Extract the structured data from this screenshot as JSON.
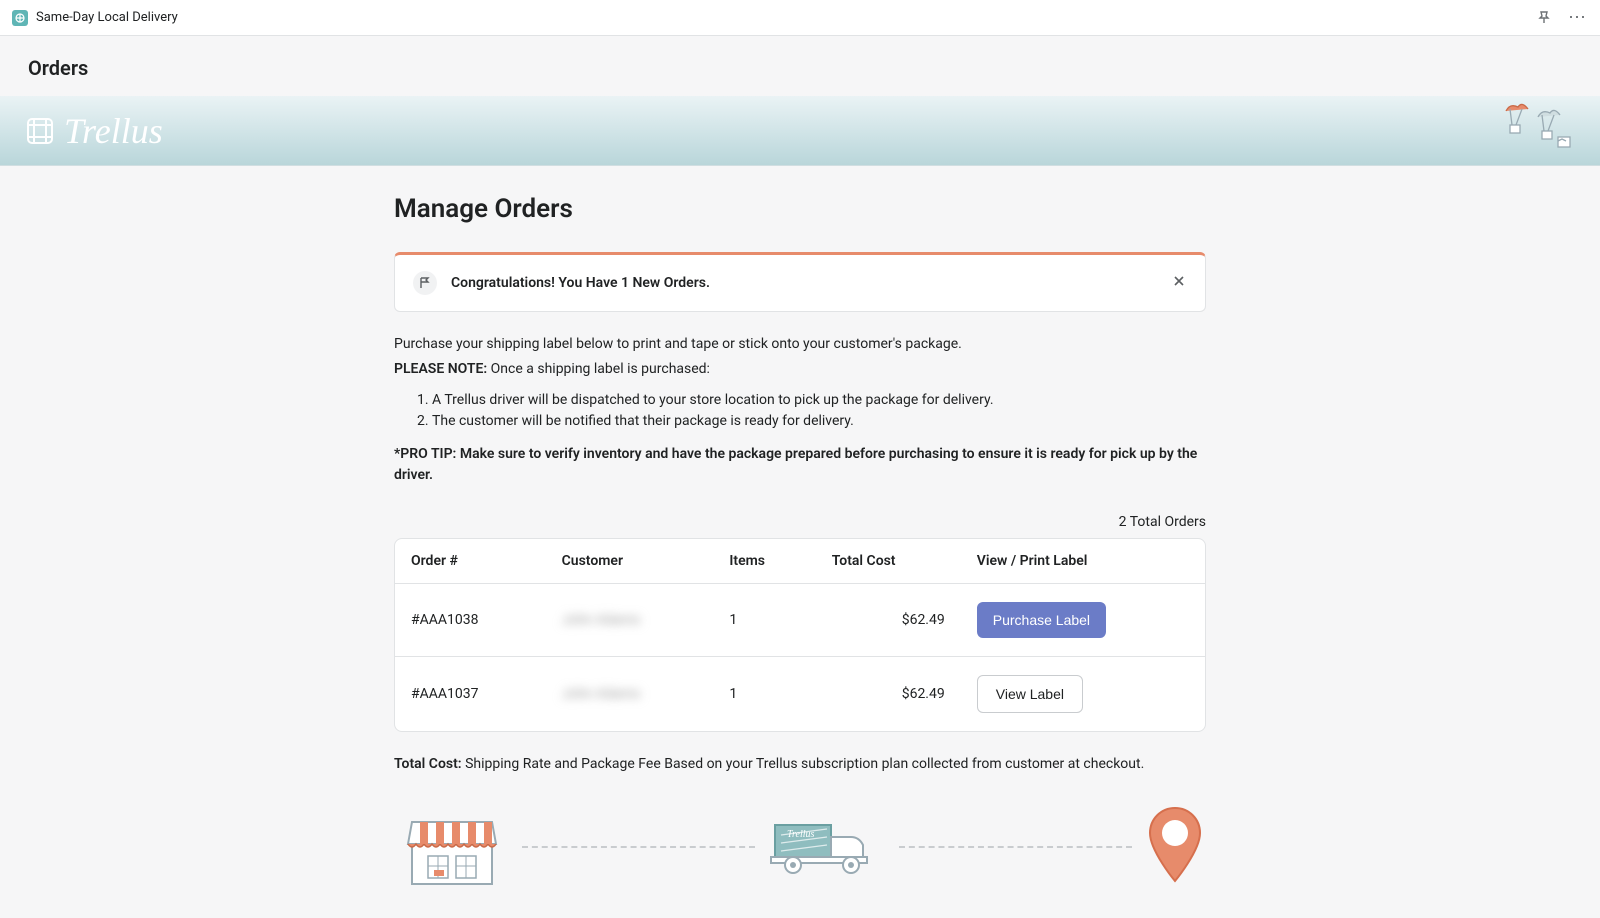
{
  "topbar": {
    "app_title": "Same-Day Local Delivery"
  },
  "page_header": "Orders",
  "brand_name": "Trellus",
  "main_title": "Manage Orders",
  "alert": {
    "text": "Congratulations! You Have 1 New Orders."
  },
  "info": {
    "intro": "Purchase your shipping label below to print and tape or stick onto your customer's package.",
    "please_note_label": "PLEASE NOTE:",
    "please_note_text": " Once a shipping label is purchased:",
    "list_1": "A Trellus driver will be dispatched to your store location to pick up the package for delivery.",
    "list_2": "The customer will be notified that their package is ready for delivery.",
    "pro_tip": "*PRO TIP: Make sure to verify inventory and have the package prepared before purchasing to ensure it is ready for pick up by the driver."
  },
  "orders_count": "2 Total Orders",
  "table": {
    "headers": {
      "order_num": "Order #",
      "customer": "Customer",
      "items": "Items",
      "total_cost": "Total Cost",
      "view_print": "View / Print Label"
    },
    "rows": [
      {
        "order_num": "#AAA1038",
        "customer": "John Adams",
        "items": "1",
        "total_cost": "$62.49",
        "button_label": "Purchase Label",
        "button_style": "primary"
      },
      {
        "order_num": "#AAA1037",
        "customer": "John Adams",
        "items": "1",
        "total_cost": "$62.49",
        "button_label": "View Label",
        "button_style": "secondary"
      }
    ]
  },
  "footer_note": {
    "label": "Total Cost:",
    "text": " Shipping Rate and Package Fee Based on your Trellus subscription plan collected from customer at checkout."
  },
  "truck_label": "Trellus"
}
